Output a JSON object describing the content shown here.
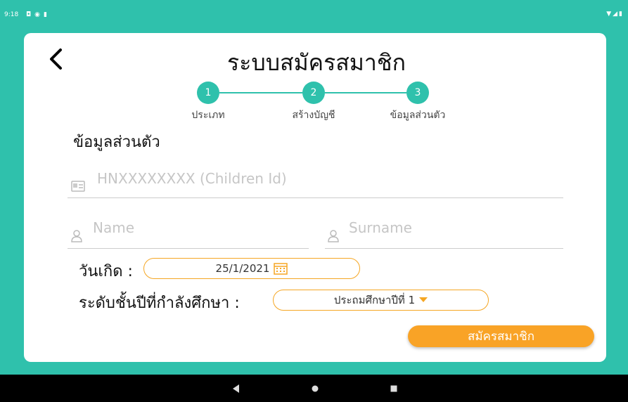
{
  "status": {
    "time": "9:18"
  },
  "header": {
    "title": "ระบบสมัครสมาชิก"
  },
  "stepper": {
    "steps": [
      {
        "number": "1",
        "label": "ประเภท"
      },
      {
        "number": "2",
        "label": "สร้างบัญชี"
      },
      {
        "number": "3",
        "label": "ข้อมูลส่วนตัว"
      }
    ]
  },
  "form": {
    "section_title": "ข้อมูลส่วนตัว",
    "children_id_placeholder": "HNXXXXXXXX (Children Id)",
    "name_placeholder": "Name",
    "surname_placeholder": "Surname",
    "birthdate_label": "วันเกิด :",
    "birthdate_value": "25/1/2021",
    "grade_label": "ระดับชั้นปีที่กำลังศึกษา :",
    "grade_value": "ประถมศึกษาปีที่ 1",
    "submit_label": "สมัครสมาชิก"
  },
  "colors": {
    "accent": "#2fc1ac",
    "button": "#f9a326"
  },
  "icons": [
    "back-arrow-icon",
    "id-card-icon",
    "person-icon",
    "calendar-icon",
    "dropdown-arrow-icon"
  ]
}
